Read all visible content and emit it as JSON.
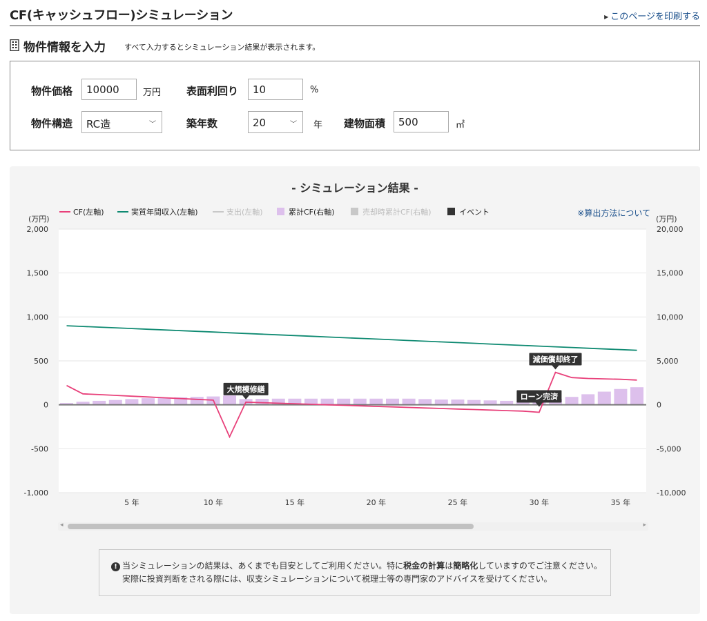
{
  "header": {
    "title": "CF(キャッシュフロー)シミュレーション",
    "print_link": "このページを印刷する"
  },
  "section": {
    "title": "物件情報を入力",
    "note": "すべて入力するとシミュレーション結果が表示されます。"
  },
  "form": {
    "price_label": "物件価格",
    "price_value": "10000",
    "price_unit": "万円",
    "yield_label": "表面利回り",
    "yield_value": "10",
    "yield_unit": "%",
    "structure_label": "物件構造",
    "structure_value": "RC造",
    "age_label": "築年数",
    "age_value": "20",
    "age_unit": "年",
    "area_label": "建物面積",
    "area_value": "500",
    "area_unit": "㎡"
  },
  "result": {
    "title": "- シミュレーション結果 -",
    "calc_link": "※算出方法について",
    "left_unit": "(万円)",
    "right_unit": "(万円)",
    "notice_prefix": "当シミュレーションの結果は、あくまでも目安としてご利用ください。特に",
    "notice_bold1": "税金の計算",
    "notice_mid": "は",
    "notice_bold2": "簡略化",
    "notice_suffix": "していますのでご注意ください。",
    "notice_line2": "実際に投資判断をされる際には、収支シミュレーションについて税理士等の専門家のアドバイスを受けてください。"
  },
  "chart_data": {
    "type": "line",
    "legend": [
      {
        "label": "CF(左軸)",
        "color": "#e8407a",
        "kind": "line",
        "enabled": true
      },
      {
        "label": "実質年間収入(左軸)",
        "color": "#0f8a72",
        "kind": "line",
        "enabled": true
      },
      {
        "label": "支出(左軸)",
        "color": "#c8c8c8",
        "kind": "line",
        "enabled": false
      },
      {
        "label": "累計CF(右軸)",
        "color": "#ddc0ec",
        "kind": "box",
        "enabled": true
      },
      {
        "label": "売却時累計CF(右軸)",
        "color": "#c8c8c8",
        "kind": "box",
        "enabled": false
      },
      {
        "label": "イベント",
        "color": "#333333",
        "kind": "box",
        "enabled": true
      }
    ],
    "x_ticks": [
      {
        "year": 5,
        "label": "5 年"
      },
      {
        "year": 10,
        "label": "10 年"
      },
      {
        "year": 15,
        "label": "15 年"
      },
      {
        "year": 20,
        "label": "20 年"
      },
      {
        "year": 25,
        "label": "25 年"
      },
      {
        "year": 30,
        "label": "30 年"
      },
      {
        "year": 35,
        "label": "35 年"
      }
    ],
    "left_axis": {
      "ylim": [
        -1000,
        2000
      ],
      "ticks": [
        {
          "v": 2000,
          "label": "2,000"
        },
        {
          "v": 1500,
          "label": "1,500"
        },
        {
          "v": 1000,
          "label": "1,000"
        },
        {
          "v": 500,
          "label": "500"
        },
        {
          "v": 0,
          "label": "0"
        },
        {
          "v": -500,
          "label": "-500"
        },
        {
          "v": -1000,
          "label": "-1,000"
        }
      ]
    },
    "right_axis": {
      "ylim": [
        -10000,
        20000
      ],
      "ticks": [
        {
          "v": 20000,
          "label": "20,000"
        },
        {
          "v": 15000,
          "label": "15,000"
        },
        {
          "v": 10000,
          "label": "10,000"
        },
        {
          "v": 5000,
          "label": "5,000"
        },
        {
          "v": 0,
          "label": "0"
        },
        {
          "v": -5000,
          "label": "-5,000"
        },
        {
          "v": -10000,
          "label": "-10,000"
        }
      ]
    },
    "years": [
      1,
      2,
      3,
      4,
      5,
      6,
      7,
      8,
      9,
      10,
      11,
      12,
      13,
      14,
      15,
      16,
      17,
      18,
      19,
      20,
      21,
      22,
      23,
      24,
      25,
      26,
      27,
      28,
      29,
      30,
      31,
      32,
      33,
      34,
      35,
      36
    ],
    "income": [
      900,
      892,
      884,
      876,
      868,
      860,
      852,
      844,
      836,
      828,
      820,
      812,
      804,
      796,
      788,
      780,
      772,
      764,
      756,
      748,
      740,
      732,
      724,
      716,
      708,
      700,
      692,
      684,
      676,
      668,
      660,
      652,
      644,
      636,
      628,
      620
    ],
    "cf": [
      220,
      125,
      116,
      107,
      98,
      89,
      80,
      71,
      62,
      53,
      -365,
      30,
      24,
      18,
      12,
      6,
      0,
      -6,
      -12,
      -18,
      -24,
      -30,
      -36,
      -42,
      -48,
      -54,
      -60,
      -66,
      -72,
      -85,
      370,
      310,
      300,
      295,
      290,
      282
    ],
    "cumulative_cf": [
      200,
      350,
      450,
      550,
      650,
      750,
      800,
      850,
      900,
      950,
      1050,
      650,
      680,
      700,
      700,
      700,
      700,
      700,
      700,
      700,
      700,
      700,
      650,
      600,
      600,
      550,
      500,
      450,
      400,
      350,
      650,
      900,
      1200,
      1500,
      1800,
      2000
    ],
    "events": [
      {
        "year": 12,
        "label": "大規模修繕"
      },
      {
        "year": 30,
        "label": "ローン完済"
      },
      {
        "year": 31,
        "label": "減価償却終了"
      }
    ]
  }
}
